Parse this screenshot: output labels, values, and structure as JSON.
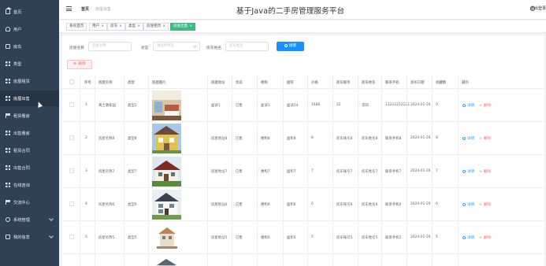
{
  "app": {
    "title": "基于Java的二手房管理服务平台",
    "logout": "退出登录"
  },
  "breadcrumb": {
    "home": "首页",
    "sep": "/",
    "current": "房屋出售"
  },
  "sidebar": {
    "items": [
      {
        "label": "首页",
        "icon": "home-icon"
      },
      {
        "label": "用户",
        "icon": "user-icon"
      },
      {
        "label": "房东",
        "icon": "card-icon"
      },
      {
        "label": "类型",
        "icon": "grid-icon"
      },
      {
        "label": "房屋租赁",
        "icon": "grid-icon"
      },
      {
        "label": "房屋出售",
        "icon": "grid-icon"
      },
      {
        "label": "租赁看房",
        "icon": "flag-icon"
      },
      {
        "label": "出售看房",
        "icon": "grid-icon"
      },
      {
        "label": "租赁合同",
        "icon": "grid-icon"
      },
      {
        "label": "出售合同",
        "icon": "grid-icon"
      },
      {
        "label": "在线咨询",
        "icon": "grid-icon"
      },
      {
        "label": "交流中心",
        "icon": "flag-icon"
      },
      {
        "label": "系统管理",
        "icon": "gear-icon"
      },
      {
        "label": "我的信息",
        "icon": "doc-icon"
      }
    ]
  },
  "tags": [
    {
      "label": "系统首页",
      "close": ""
    },
    {
      "label": "用户",
      "close": "×"
    },
    {
      "label": "房东",
      "close": "×"
    },
    {
      "label": "类型",
      "close": "×"
    },
    {
      "label": "房屋租赁",
      "close": "×"
    },
    {
      "label": "房屋出售",
      "close": "×"
    }
  ],
  "filters": {
    "house_name": {
      "label": "房屋名称",
      "placeholder": "房屋名称"
    },
    "status": {
      "label": "状态",
      "placeholder": "请选择状态"
    },
    "owner_name": {
      "label": "房东姓名",
      "placeholder": "房东姓名"
    },
    "search_button": "搜索",
    "delete_button": "删除"
  },
  "table": {
    "columns": [
      "序号",
      "房屋名称",
      "类型",
      "房屋图片",
      "房屋地址",
      "状态",
      "楼构",
      "面积",
      "价格",
      "房东账号",
      "房东姓名",
      "联系手机",
      "发布日期",
      "收藏数",
      "操作"
    ],
    "rows": [
      {
        "idx": "1",
        "name": "黄土墩家园",
        "type": "类型2",
        "addr": "面试1",
        "status": "已售",
        "floor": "面试1",
        "area": "面试24",
        "price": "1688",
        "account": "22",
        "owner": "李四",
        "phone": "13222222222",
        "date": "2024-01-26",
        "fav": "0"
      },
      {
        "idx": "2",
        "name": "房屋名称8",
        "type": "类型8",
        "addr": "房屋地址8",
        "status": "已售",
        "floor": "楼构8",
        "area": "面积8",
        "price": "8",
        "account": "房东账号8",
        "owner": "房东姓名8",
        "phone": "联系手机8",
        "date": "2024-01-26",
        "fav": "8"
      },
      {
        "idx": "3",
        "name": "房屋名称7",
        "type": "类型7",
        "addr": "房屋地址7",
        "status": "已售",
        "floor": "楼构7",
        "area": "面积7",
        "price": "7",
        "account": "房东账号7",
        "owner": "房东姓名7",
        "phone": "联系手机7",
        "date": "2024-01-26",
        "fav": "7"
      },
      {
        "idx": "4",
        "name": "房屋名称6",
        "type": "类型6",
        "addr": "房屋地址6",
        "status": "已售",
        "floor": "楼构6",
        "area": "面积6",
        "price": "6",
        "account": "房东账号6",
        "owner": "房东姓名6",
        "phone": "联系手机6",
        "date": "2024-01-26",
        "fav": "6"
      },
      {
        "idx": "5",
        "name": "房屋名称5",
        "type": "类型5",
        "addr": "房屋地址5",
        "status": "已售",
        "floor": "楼构5",
        "area": "面积5",
        "price": "5",
        "account": "房东账号5",
        "owner": "房东姓名5",
        "phone": "联系手机5",
        "date": "2024-01-26",
        "fav": "5"
      }
    ],
    "detail_label": "详情",
    "delete_label": "删除"
  },
  "colors": {
    "sidebar": "#304156",
    "accent": "#1890ff",
    "tag_active": "#42b983",
    "danger": "#f56c6c"
  }
}
